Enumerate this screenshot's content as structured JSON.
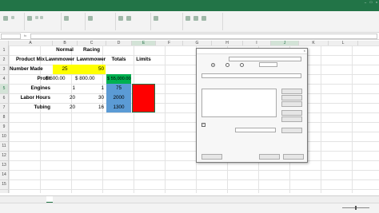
{
  "app": {
    "colors": {
      "excel_green": "#227447",
      "yellow": "#ffff00",
      "blue": "#5b9bd5",
      "red": "#ff0000"
    }
  },
  "ribbon": {
    "tabs": [
      "",
      "",
      "",
      "",
      "",
      "",
      "",
      "",
      ""
    ],
    "icons": [
      "clipboard-icon",
      "font-icon",
      "align-icon",
      "number-format-icon",
      "conditional-format-icon",
      "cells-icon",
      "editing-icon",
      "sort-filter-icon",
      "find-select-icon"
    ]
  },
  "formula_bar": {
    "name_box": "",
    "fx": "fx",
    "formula": ""
  },
  "columns": [
    "A",
    "B",
    "C",
    "D",
    "E",
    "F",
    "G",
    "H",
    "I",
    "J",
    "K",
    "L"
  ],
  "rows": [
    "1",
    "2",
    "3",
    "4",
    "5",
    "6",
    "7",
    "8",
    "9",
    "10",
    "11",
    "12",
    "13",
    "14",
    "15"
  ],
  "sheet": {
    "header_row1": {
      "b": "Normal",
      "c": "Racing"
    },
    "header_row2": {
      "a": "Product Mix",
      "b": "Lawnmower",
      "c": "Lawnmower",
      "d": "Totals",
      "e": "Limits"
    },
    "number_made": {
      "a": "Number Made",
      "b": "25",
      "c": "50"
    },
    "profit": {
      "a": "Profit",
      "b": "$   600.00",
      "c": "$   800.00",
      "d": "$ 55,000.00"
    },
    "engines": {
      "a": "Engines",
      "b": "1",
      "c": "1",
      "d": "75"
    },
    "labor_hours": {
      "a": "Labor Hours",
      "b": "20",
      "c": "30",
      "d": "2000"
    },
    "tubing": {
      "a": "Tubing",
      "b": "20",
      "c": "16",
      "d": "1300"
    }
  },
  "dialog": {
    "title": "",
    "set_objective_label": "",
    "set_objective_value": "",
    "to_label": "",
    "opt_max": "",
    "opt_min": "",
    "opt_value": "",
    "value_of": "",
    "by_changing_label": "",
    "by_changing_value": "",
    "subject_to_label": "",
    "constraints": [
      "",
      "",
      "",
      "",
      ""
    ],
    "btn_add": "",
    "btn_change": "",
    "btn_delete": "",
    "btn_reset": "",
    "btn_load_save": "",
    "unconstrained_label": "",
    "select_method_label": "",
    "method_value": "",
    "btn_options": "",
    "solving_method_label": "",
    "solving_method_text": "",
    "btn_help": "",
    "btn_solve": "",
    "btn_close": ""
  },
  "sheet_tabs": [
    "",
    ""
  ],
  "status": {
    "ready": ""
  }
}
